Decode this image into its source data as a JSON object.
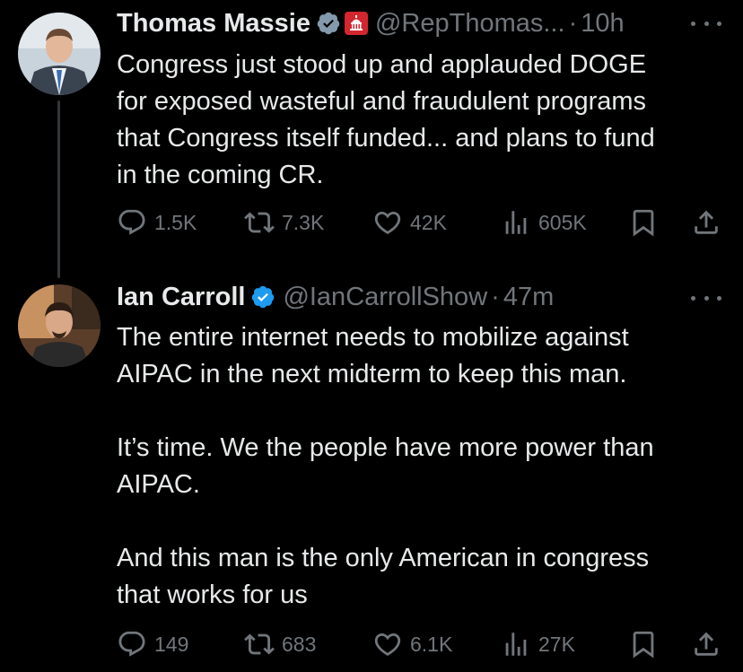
{
  "tweets": [
    {
      "author_name": "Thomas Massie",
      "handle": "@RepThomas...",
      "separator": "·",
      "time": "10h",
      "text": "Congress just stood up and applauded DOGE\nfor exposed wasteful and fraudulent programs\nthat Congress itself funded... and plans to fund\nin the coming CR.",
      "replies": "1.5K",
      "reposts": "7.3K",
      "likes": "42K",
      "views": "605K"
    },
    {
      "author_name": "Ian Carroll",
      "handle": "@IanCarrollShow",
      "separator": "·",
      "time": "47m",
      "text": "The entire internet needs to mobilize against\nAIPAC in the next midterm to keep this man.\n\nIt’s time. We the people have more power than\nAIPAC.\n\nAnd this man is the only American in congress\nthat works for us",
      "replies": "149",
      "reposts": "683",
      "likes": "6.1K",
      "views": "27K"
    }
  ],
  "colors": {
    "background": "#000000",
    "text": "#e7e9ea",
    "muted": "#71767b",
    "verified": "#1d9bf0",
    "gov_badge": "#d3262f",
    "thread_line": "#333639"
  },
  "icons": [
    "verified-badge-icon",
    "government-badge-icon",
    "more-icon",
    "reply-icon",
    "repost-icon",
    "like-icon",
    "views-icon",
    "bookmark-icon",
    "share-icon"
  ]
}
